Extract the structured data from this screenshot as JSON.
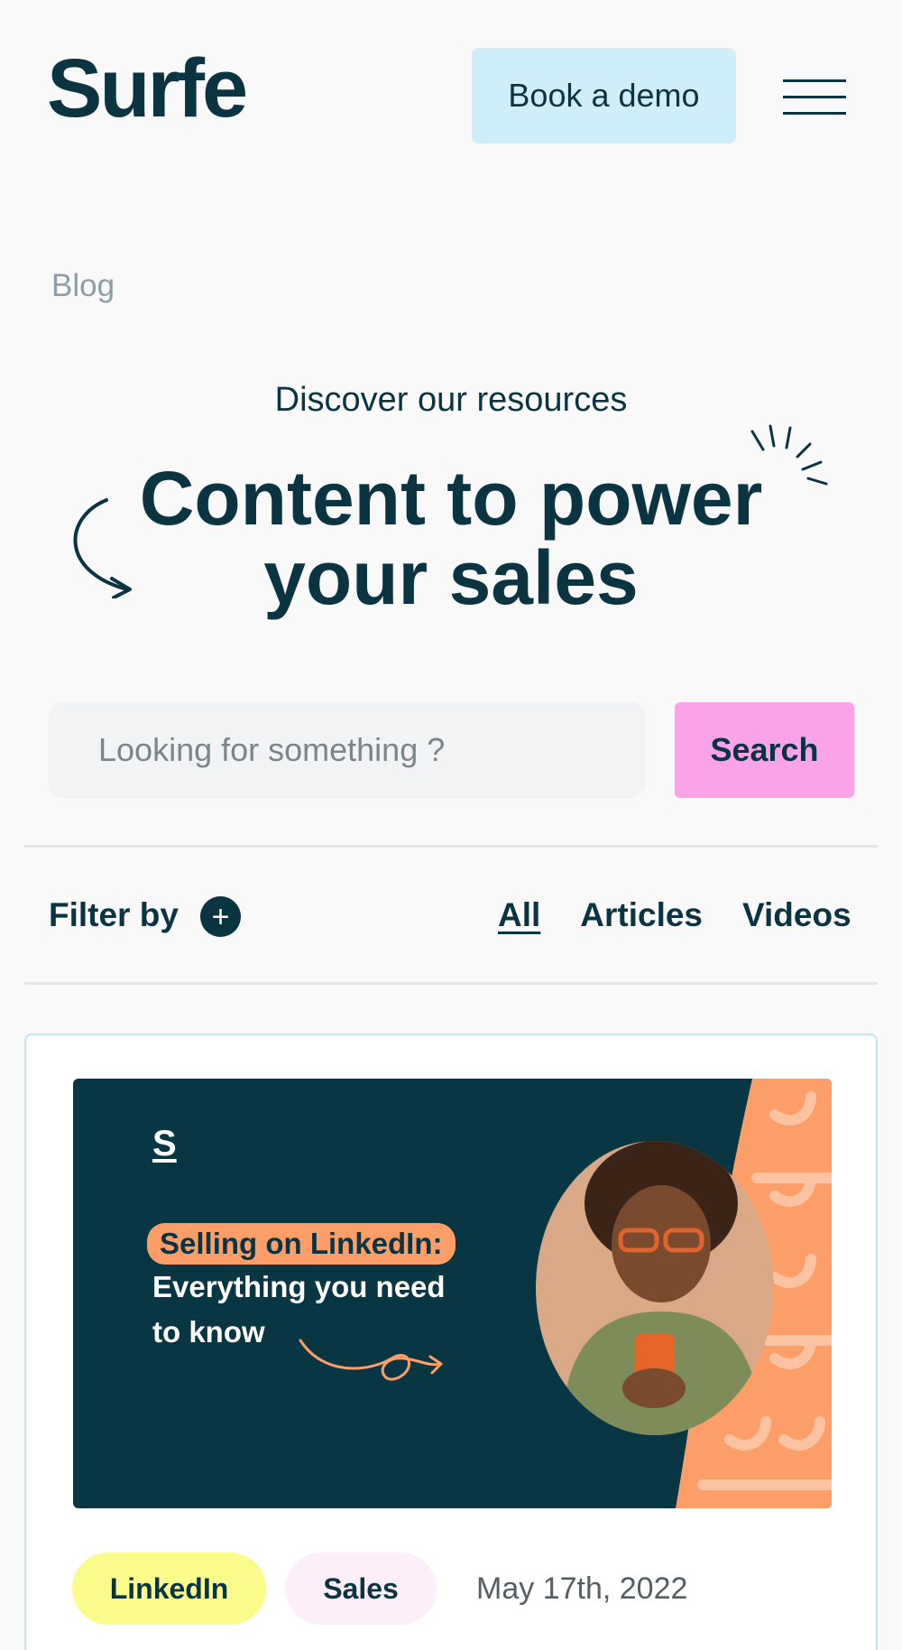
{
  "header": {
    "logo": "Surfe",
    "demo_label": "Book a demo",
    "menu_icon": "hamburger-menu-icon"
  },
  "breadcrumb": "Blog",
  "hero": {
    "eyebrow": "Discover our resources",
    "title_line1": "Content to power",
    "title_line2": "your sales"
  },
  "search": {
    "placeholder": "Looking for something ?",
    "value": "",
    "button_label": "Search"
  },
  "filter": {
    "label": "Filter by",
    "plus_icon": "+",
    "tabs": [
      {
        "label": "All",
        "active": true
      },
      {
        "label": "Articles",
        "active": false
      },
      {
        "label": "Videos",
        "active": false
      }
    ]
  },
  "card": {
    "thumb_logo": "S",
    "thumb_highlight": "Selling on LinkedIn:",
    "thumb_line1": "Everything you need",
    "thumb_line2": "to know",
    "tags": [
      "LinkedIn",
      "Sales"
    ],
    "date": "May 17th, 2022"
  },
  "colors": {
    "brand": "#0b3442",
    "demo_bg": "#d0eefa",
    "search_btn_bg": "#fba3e8",
    "tag_linkedin": "#fbfb8b",
    "tag_sales": "#fdeff9",
    "thumb_bg": "#083643",
    "accent_orange": "#fd9e69"
  }
}
